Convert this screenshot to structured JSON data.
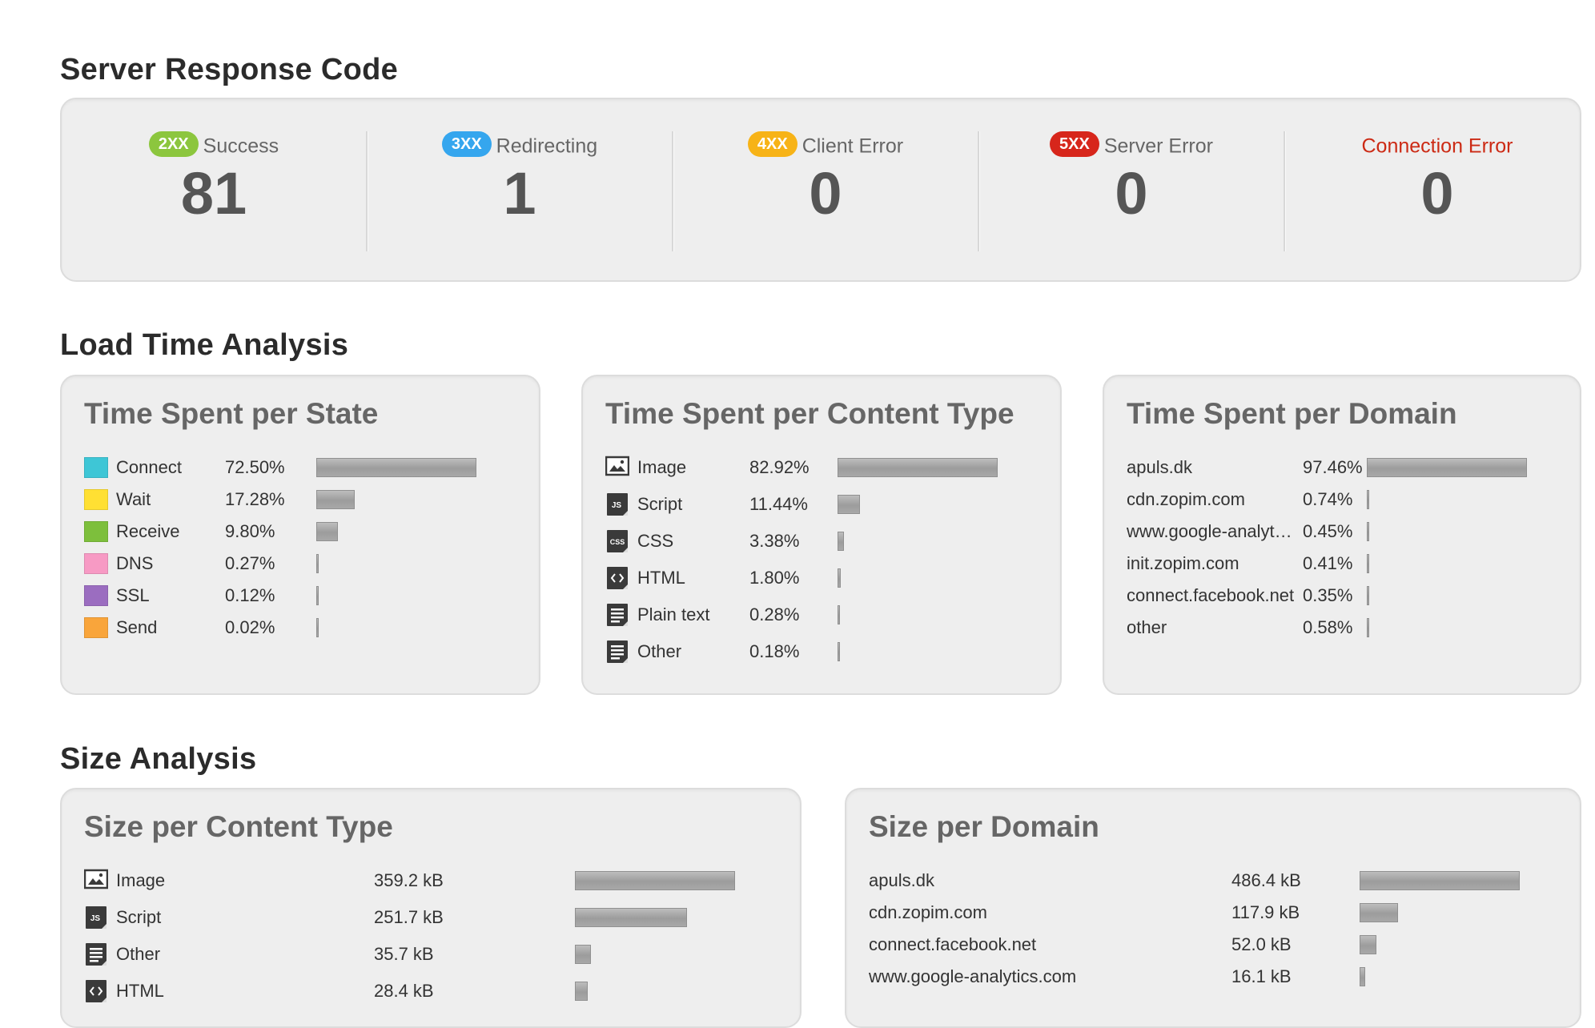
{
  "response_code": {
    "title": "Server Response Code",
    "items": [
      {
        "badge": "2XX",
        "label": "Success",
        "value": "81",
        "color": "#8cc63e"
      },
      {
        "badge": "3XX",
        "label": "Redirecting",
        "value": "1",
        "color": "#35a6ee"
      },
      {
        "badge": "4XX",
        "label": "Client Error",
        "value": "0",
        "color": "#f7b317"
      },
      {
        "badge": "5XX",
        "label": "Server Error",
        "value": "0",
        "color": "#d7261b"
      },
      {
        "badge": "",
        "label": "Connection Error",
        "value": "0",
        "color": "#cc2a14"
      }
    ]
  },
  "load_time": {
    "title": "Load Time Analysis",
    "per_state": {
      "title": "Time Spent per State",
      "rows": [
        {
          "label": "Connect",
          "value": "72.50%",
          "fraction": 0.725,
          "color": "#3ec6d6"
        },
        {
          "label": "Wait",
          "value": "17.28%",
          "fraction": 0.1728,
          "color": "#ffe033"
        },
        {
          "label": "Receive",
          "value": "9.80%",
          "fraction": 0.098,
          "color": "#7dbf3c"
        },
        {
          "label": "DNS",
          "value": "0.27%",
          "fraction": 0.0027,
          "color": "#f79ac4"
        },
        {
          "label": "SSL",
          "value": "0.12%",
          "fraction": 0.0012,
          "color": "#9b6dc0"
        },
        {
          "label": "Send",
          "value": "0.02%",
          "fraction": 0.0002,
          "color": "#f9a53b"
        }
      ]
    },
    "per_content_type": {
      "title": "Time Spent per Content Type",
      "rows": [
        {
          "label": "Image",
          "value": "82.92%",
          "fraction": 0.8292,
          "icon": "image-icon"
        },
        {
          "label": "Script",
          "value": "11.44%",
          "fraction": 0.1144,
          "icon": "script-icon"
        },
        {
          "label": "CSS",
          "value": "3.38%",
          "fraction": 0.0338,
          "icon": "css-icon"
        },
        {
          "label": "HTML",
          "value": "1.80%",
          "fraction": 0.018,
          "icon": "html-icon"
        },
        {
          "label": "Plain text",
          "value": "0.28%",
          "fraction": 0.0028,
          "icon": "text-icon"
        },
        {
          "label": "Other",
          "value": "0.18%",
          "fraction": 0.0018,
          "icon": "text-icon"
        }
      ]
    },
    "per_domain": {
      "title": "Time Spent per Domain",
      "rows": [
        {
          "label": "apuls.dk",
          "value": "97.46%",
          "fraction": 0.9746
        },
        {
          "label": "cdn.zopim.com",
          "value": "0.74%",
          "fraction": 0.0074
        },
        {
          "label": "www.google-analyt…",
          "value": "0.45%",
          "fraction": 0.0045
        },
        {
          "label": "init.zopim.com",
          "value": "0.41%",
          "fraction": 0.0041
        },
        {
          "label": "connect.facebook.net",
          "value": "0.35%",
          "fraction": 0.0035
        },
        {
          "label": "other",
          "value": "0.58%",
          "fraction": 0.0058
        }
      ]
    }
  },
  "size": {
    "title": "Size Analysis",
    "per_content_type": {
      "title": "Size per Content Type",
      "rows": [
        {
          "label": "Image",
          "value": "359.2 kB",
          "fraction": 1.0,
          "icon": "image-icon"
        },
        {
          "label": "Script",
          "value": "251.7 kB",
          "fraction": 0.7007,
          "icon": "script-icon"
        },
        {
          "label": "Other",
          "value": "35.7 kB",
          "fraction": 0.0994,
          "icon": "text-icon"
        },
        {
          "label": "HTML",
          "value": "28.4 kB",
          "fraction": 0.0791,
          "icon": "html-icon"
        }
      ]
    },
    "per_domain": {
      "title": "Size per Domain",
      "rows": [
        {
          "label": "apuls.dk",
          "value": "486.4 kB",
          "fraction": 1.0
        },
        {
          "label": "cdn.zopim.com",
          "value": "117.9 kB",
          "fraction": 0.2424
        },
        {
          "label": "connect.facebook.net",
          "value": "52.0 kB",
          "fraction": 0.1069
        },
        {
          "label": "www.google-analytics.com",
          "value": "16.1 kB",
          "fraction": 0.0331
        }
      ]
    }
  }
}
